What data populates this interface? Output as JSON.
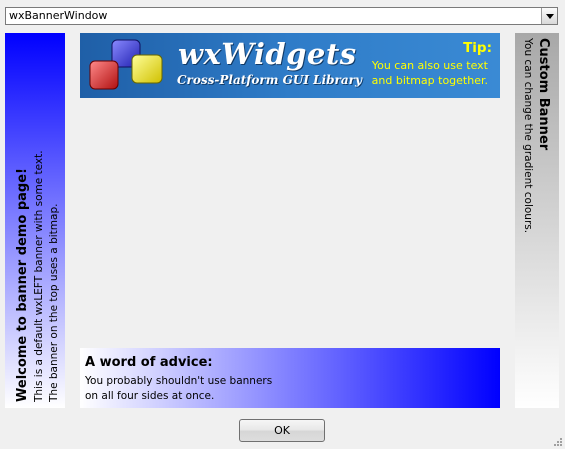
{
  "window": {
    "combo_value": "wxBannerWindow"
  },
  "left_banner": {
    "title": "Welcome to banner demo page!",
    "line1": "This is a default wxLEFT banner with some text.",
    "line2": "The banner on the top uses a bitmap.",
    "gradient": [
      "#0000ff",
      "#ffffff"
    ]
  },
  "top_banner": {
    "logo_title": "wxWidgets",
    "logo_subtitle": "Cross-Platform GUI Library",
    "tip_title": "Tip:",
    "tip_line1": "You can also use text",
    "tip_line2": "and bitmap together.",
    "background": "#2f7cc8",
    "tip_color": "#ffff00"
  },
  "right_banner": {
    "title": "Custom Banner",
    "line1": "You can change the gradient colours.",
    "gradient": [
      "#a8a8a8",
      "#ffffff"
    ]
  },
  "bottom_banner": {
    "title": "A word of advice:",
    "line1": "You probably shouldn't use banners",
    "line2": "on all four sides at once.",
    "gradient": [
      "#ffffff",
      "#0000ff"
    ]
  },
  "buttons": {
    "ok_label": "OK"
  }
}
